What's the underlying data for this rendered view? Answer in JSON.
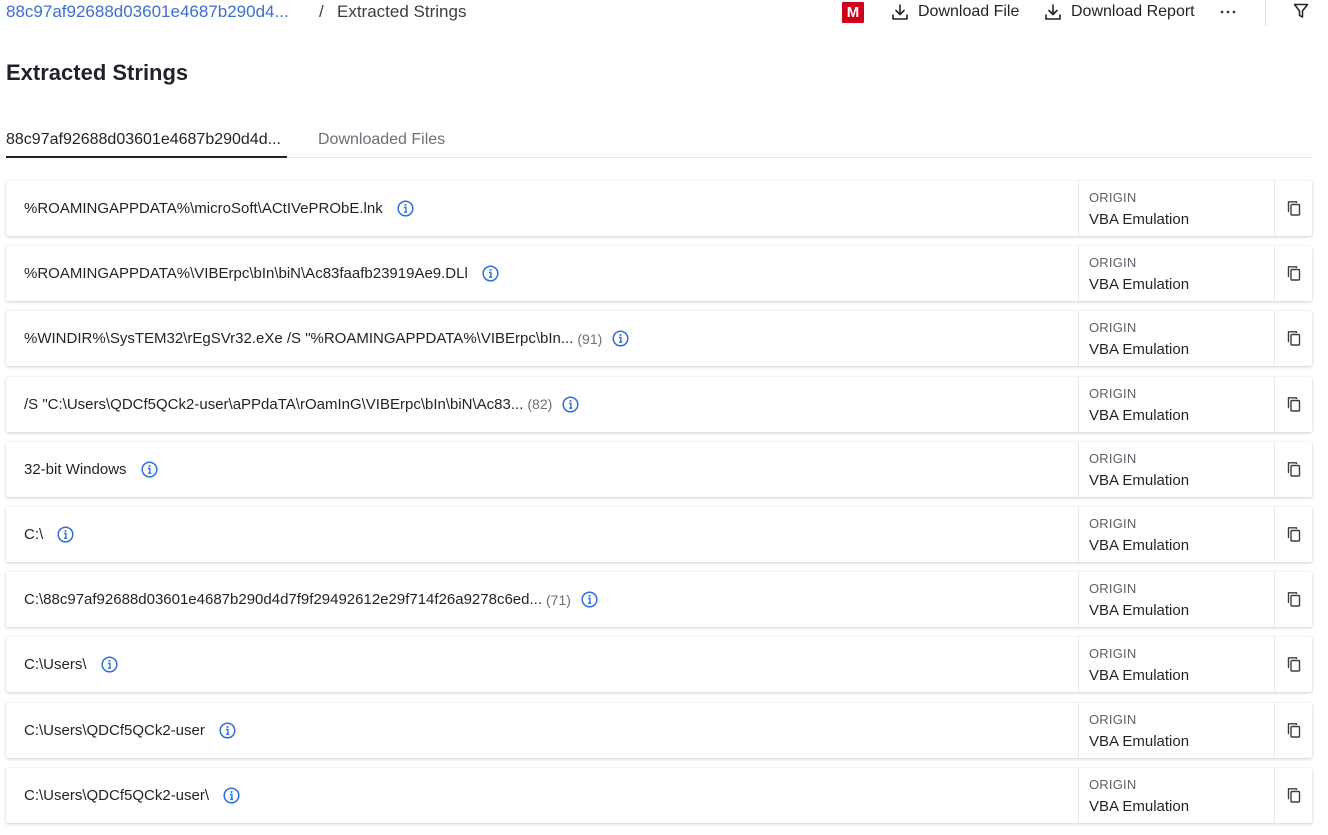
{
  "breadcrumb": {
    "parent": "88c97af92688d03601e4687b290d4...",
    "separator": "/",
    "current": "Extracted Strings"
  },
  "toolbar": {
    "badge": "M",
    "badge_color": "#d0021b",
    "download_file": "Download File",
    "download_report": "Download Report",
    "more": "···"
  },
  "page_title": "Extracted Strings",
  "tabs": [
    {
      "label": "88c97af92688d03601e4687b290d4d...",
      "active": true
    },
    {
      "label": "Downloaded Files",
      "active": false
    }
  ],
  "rows": [
    {
      "text": "%ROAMINGAPPDATA%\\microSoft\\ACtIVePRObE.lnk",
      "count": "",
      "origin_label": "ORIGIN",
      "origin": "VBA Emulation"
    },
    {
      "text": "%ROAMINGAPPDATA%\\VIBErpc\\bIn\\biN\\Ac83faafb23919Ae9.DLl",
      "count": "",
      "origin_label": "ORIGIN",
      "origin": "VBA Emulation"
    },
    {
      "text": "%WINDIR%\\SysTEM32\\rEgSVr32.eXe /S \"%ROAMINGAPPDATA%\\VIBErpc\\bIn...",
      "count": "(91)",
      "origin_label": "ORIGIN",
      "origin": "VBA Emulation"
    },
    {
      "text": "/S \"C:\\Users\\QDCf5QCk2-user\\aPPdaTA\\rOamInG\\VIBErpc\\bIn\\biN\\Ac83...",
      "count": "(82)",
      "origin_label": "ORIGIN",
      "origin": "VBA Emulation"
    },
    {
      "text": "32-bit Windows",
      "count": "",
      "origin_label": "ORIGIN",
      "origin": "VBA Emulation"
    },
    {
      "text": "C:\\",
      "count": "",
      "origin_label": "ORIGIN",
      "origin": "VBA Emulation"
    },
    {
      "text": "C:\\88c97af92688d03601e4687b290d4d7f9f29492612e29f714f26a9278c6ed...",
      "count": "(71)",
      "origin_label": "ORIGIN",
      "origin": "VBA Emulation"
    },
    {
      "text": "C:\\Users\\",
      "count": "",
      "origin_label": "ORIGIN",
      "origin": "VBA Emulation"
    },
    {
      "text": "C:\\Users\\QDCf5QCk2-user",
      "count": "",
      "origin_label": "ORIGIN",
      "origin": "VBA Emulation"
    },
    {
      "text": "C:\\Users\\QDCf5QCk2-user\\",
      "count": "",
      "origin_label": "ORIGIN",
      "origin": "VBA Emulation"
    }
  ],
  "colors": {
    "link": "#3b6fd4",
    "info_icon": "#2f6ee0"
  },
  "icons": {
    "download": "download-icon",
    "more": "more-horizontal-icon",
    "filter": "filter-icon",
    "info": "info-icon",
    "copy": "copy-icon"
  }
}
